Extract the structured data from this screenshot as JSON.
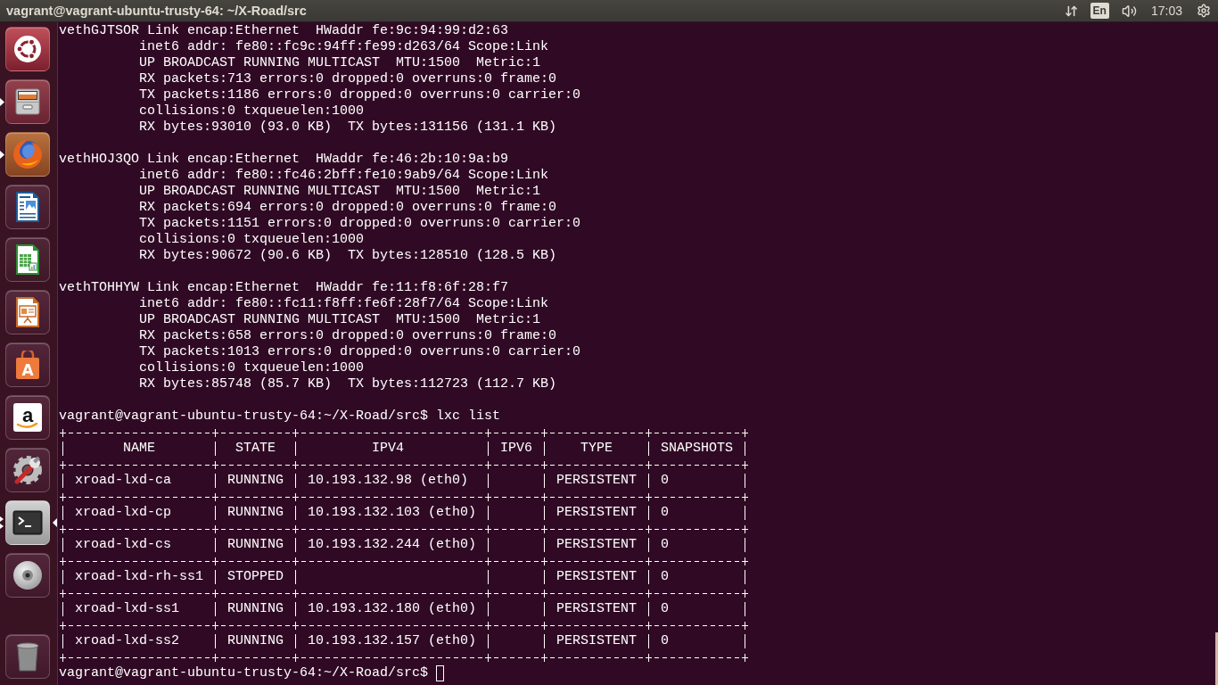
{
  "top_panel": {
    "title": "vagrant@vagrant-ubuntu-trusty-64: ~/X-Road/src",
    "keyboard_layout": "En",
    "clock": "17:03"
  },
  "launcher": {
    "items": [
      {
        "running": false,
        "multiple_windows": false,
        "focused": false
      },
      {
        "running": true,
        "multiple_windows": false,
        "focused": false
      },
      {
        "running": true,
        "multiple_windows": false,
        "focused": false
      },
      {
        "running": false,
        "multiple_windows": false,
        "focused": false
      },
      {
        "running": false,
        "multiple_windows": false,
        "focused": false
      },
      {
        "running": false,
        "multiple_windows": false,
        "focused": false
      },
      {
        "running": false,
        "multiple_windows": false,
        "focused": false,
        "glyph": "A"
      },
      {
        "running": false,
        "multiple_windows": false,
        "focused": false,
        "glyph": "a"
      },
      {
        "running": false,
        "multiple_windows": false,
        "focused": false
      },
      {
        "running": true,
        "multiple_windows": true,
        "focused": true
      },
      {
        "running": false,
        "multiple_windows": false,
        "focused": false
      }
    ],
    "bottom_items": [
      {
        "running": false,
        "multiple_windows": false,
        "focused": false
      }
    ]
  },
  "terminal": {
    "interfaces": [
      {
        "name": "vethGJTSOR",
        "summary": "Link encap:Ethernet  HWaddr fe:9c:94:99:d2:63",
        "details": [
          "inet6 addr: fe80::fc9c:94ff:fe99:d263/64 Scope:Link",
          "UP BROADCAST RUNNING MULTICAST  MTU:1500  Metric:1",
          "RX packets:713 errors:0 dropped:0 overruns:0 frame:0",
          "TX packets:1186 errors:0 dropped:0 overruns:0 carrier:0",
          "collisions:0 txqueuelen:1000",
          "RX bytes:93010 (93.0 KB)  TX bytes:131156 (131.1 KB)"
        ]
      },
      {
        "name": "vethHOJ3QO",
        "summary": "Link encap:Ethernet  HWaddr fe:46:2b:10:9a:b9",
        "details": [
          "inet6 addr: fe80::fc46:2bff:fe10:9ab9/64 Scope:Link",
          "UP BROADCAST RUNNING MULTICAST  MTU:1500  Metric:1",
          "RX packets:694 errors:0 dropped:0 overruns:0 frame:0",
          "TX packets:1151 errors:0 dropped:0 overruns:0 carrier:0",
          "collisions:0 txqueuelen:1000",
          "RX bytes:90672 (90.6 KB)  TX bytes:128510 (128.5 KB)"
        ]
      },
      {
        "name": "vethTOHHYW",
        "summary": "Link encap:Ethernet  HWaddr fe:11:f8:6f:28:f7",
        "details": [
          "inet6 addr: fe80::fc11:f8ff:fe6f:28f7/64 Scope:Link",
          "UP BROADCAST RUNNING MULTICAST  MTU:1500  Metric:1",
          "RX packets:658 errors:0 dropped:0 overruns:0 frame:0",
          "TX packets:1013 errors:0 dropped:0 overruns:0 carrier:0",
          "collisions:0 txqueuelen:1000",
          "RX bytes:85748 (85.7 KB)  TX bytes:112723 (112.7 KB)"
        ]
      }
    ],
    "command": {
      "prompt": "vagrant@vagrant-ubuntu-trusty-64:~/X-Road/src$",
      "input": "lxc list"
    },
    "table": {
      "columns": [
        "NAME",
        "STATE",
        "IPV4",
        "IPV6",
        "TYPE",
        "SNAPSHOTS"
      ],
      "rows": [
        {
          "name": "xroad-lxd-ca",
          "state": "RUNNING",
          "ipv4": "10.193.132.98 (eth0)",
          "type": "PERSISTENT",
          "snapshots": "0"
        },
        {
          "name": "xroad-lxd-cp",
          "state": "RUNNING",
          "ipv4": "10.193.132.103 (eth0)",
          "type": "PERSISTENT",
          "snapshots": "0"
        },
        {
          "name": "xroad-lxd-cs",
          "state": "RUNNING",
          "ipv4": "10.193.132.244 (eth0)",
          "type": "PERSISTENT",
          "snapshots": "0"
        },
        {
          "name": "xroad-lxd-rh-ss1",
          "state": "STOPPED",
          "type": "PERSISTENT",
          "snapshots": "0"
        },
        {
          "name": "xroad-lxd-ss1",
          "state": "RUNNING",
          "ipv4": "10.193.132.180 (eth0)",
          "type": "PERSISTENT",
          "snapshots": "0"
        },
        {
          "name": "xroad-lxd-ss2",
          "state": "RUNNING",
          "ipv4": "10.193.132.157 (eth0)",
          "type": "PERSISTENT",
          "snapshots": "0"
        }
      ]
    },
    "current_prompt": {
      "prompt": "vagrant@vagrant-ubuntu-trusty-64:~/X-Road/src$"
    }
  }
}
